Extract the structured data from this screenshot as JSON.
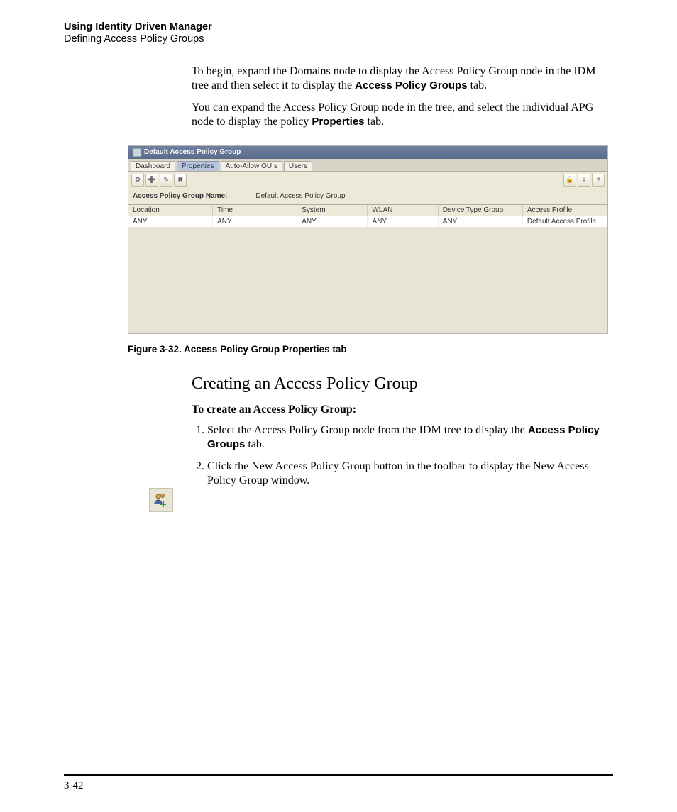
{
  "header": {
    "title": "Using Identity Driven Manager",
    "subtitle": "Defining Access Policy Groups"
  },
  "intro": {
    "p1a": "To begin, expand the Domains node to display the Access Policy Group node in the IDM tree and then select it to display the ",
    "p1b": "Access Policy Groups",
    "p1c": " tab.",
    "p2a": "You can expand the Access Policy Group node in the tree, and select the individual APG node to display the policy ",
    "p2b": "Properties",
    "p2c": " tab."
  },
  "screenshot": {
    "windowTitle": "Default Access Policy Group",
    "tabs": [
      "Dashboard",
      "Properties",
      "Auto-Allow OUIs",
      "Users"
    ],
    "activeTab": "Properties",
    "nameLabel": "Access Policy Group Name:",
    "nameValue": "Default Access Policy Group",
    "columns": [
      "Location",
      "Time",
      "System",
      "WLAN",
      "Device Type Group",
      "Access Profile"
    ],
    "row": [
      "ANY",
      "ANY",
      "ANY",
      "ANY",
      "ANY",
      "Default Access Profile"
    ]
  },
  "caption": "Figure 3-32. Access Policy Group Properties tab",
  "section": {
    "heading": "Creating an Access Policy Group",
    "lead": "To create an Access Policy Group:",
    "step1a": "Select the Access Policy Group node from the IDM tree to display the ",
    "step1b": "Access Policy Groups",
    "step1c": " tab.",
    "step2": "Click the New Access Policy Group button in the toolbar to display the New Access Policy Group window."
  },
  "pageNumber": "3-42"
}
